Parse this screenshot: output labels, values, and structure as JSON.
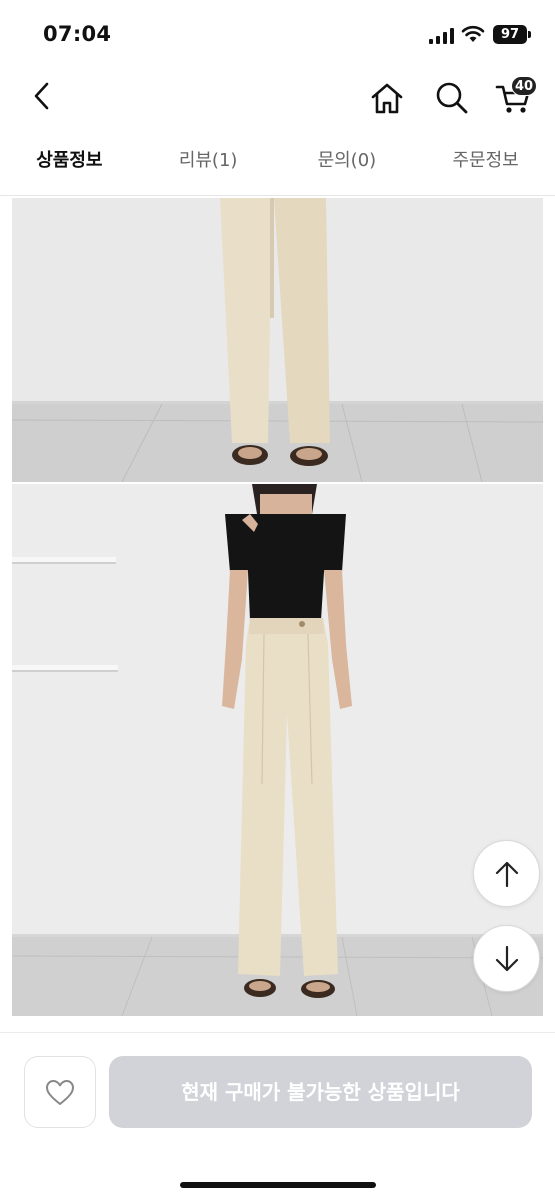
{
  "status_bar": {
    "time": "07:04",
    "battery": "97",
    "icons": [
      "signal-icon",
      "wifi-icon",
      "battery-icon"
    ]
  },
  "header": {
    "icons": [
      "back-icon",
      "home-icon",
      "search-icon",
      "cart-icon"
    ],
    "cart_count": "40"
  },
  "tabs": [
    {
      "label": "상품정보",
      "active": true
    },
    {
      "label": "리뷰(1)",
      "active": false
    },
    {
      "label": "문의(0)",
      "active": false
    },
    {
      "label": "주문정보",
      "active": false
    }
  ],
  "floating_buttons": {
    "icons": [
      "arrow-up-icon",
      "arrow-down-icon"
    ]
  },
  "bottom_bar": {
    "wishlist_icon": "heart-icon",
    "purchase_label": "현재 구매가 불가능한 상품입니다"
  },
  "colors": {
    "purchase_disabled": "#d1d3d9",
    "pants": "#e8dcc4",
    "top": "#141414"
  }
}
